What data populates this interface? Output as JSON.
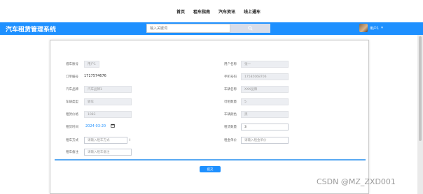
{
  "topnav": {
    "items": [
      "首页",
      "租车指南",
      "汽车资讯",
      "线上通车"
    ]
  },
  "header": {
    "logo": "汽车租赁管理系统",
    "search_placeholder": "输入关键词",
    "username": "用户1",
    "bg_color": "#1e90ff"
  },
  "form": {
    "left": [
      {
        "label": "借车账号",
        "value": "用户1",
        "kind": "readonly"
      },
      {
        "label": "订单编号",
        "value": "1717574676",
        "kind": "plain"
      },
      {
        "label": "汽车品牌",
        "value": "汽车品牌1",
        "kind": "readonly"
      },
      {
        "label": "车辆类型",
        "value": "轿车",
        "kind": "readonly"
      },
      {
        "label": "租赁价格",
        "value": "1083",
        "kind": "readonly"
      },
      {
        "label": "租赁时间",
        "value": "2024-03-20",
        "kind": "date"
      },
      {
        "label": "租车方式",
        "value": "请输入租车方式",
        "kind": "input"
      },
      {
        "label": "租车备注",
        "value": "请输入租车备注",
        "kind": "input"
      }
    ],
    "right": [
      {
        "label": "用户名称",
        "value": "张一",
        "kind": "readonly"
      },
      {
        "label": "手机号码",
        "value": "17585068706",
        "kind": "readonly"
      },
      {
        "label": "车辆名称",
        "value": "XXX品牌",
        "kind": "readonly"
      },
      {
        "label": "可租数量",
        "value": "5",
        "kind": "readonly"
      },
      {
        "label": "车辆颜色",
        "value": "黑",
        "kind": "readonly"
      },
      {
        "label": "租赁数量",
        "value": "3",
        "kind": "edit"
      },
      {
        "label": "租金单价",
        "value": "请输入租金单价",
        "kind": "input"
      }
    ],
    "submit_label": "提交"
  },
  "watermark": "CSDN @MZ_ZXD001"
}
